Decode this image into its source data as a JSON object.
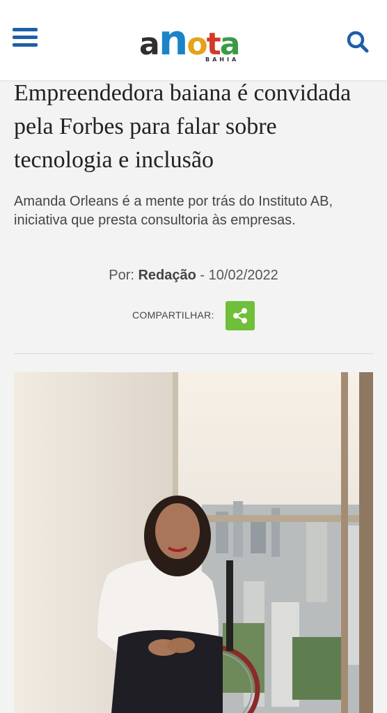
{
  "header": {
    "logo": {
      "a": "a",
      "n": "n",
      "o": "o",
      "t": "t",
      "a2": "a",
      "sub": "BAHIA"
    },
    "menu_icon": "hamburger-menu-icon",
    "search_icon": "search-icon",
    "brand_color": "#1f5ea8"
  },
  "article": {
    "headline": "Empreendedora baiana é convidada pela Forbes para falar sobre tecnologia e inclusão",
    "subtitle": "Amanda Orleans é a mente por trás do Instituto AB, iniciativa que presta consultoria às empresas.",
    "byline_prefix": "Por:",
    "author": "Redação",
    "byline_sep": "-",
    "date": "10/02/2022",
    "share_label": "COMPARTILHAR:",
    "share_icon": "share-icon",
    "share_color": "#6fbf3b"
  }
}
